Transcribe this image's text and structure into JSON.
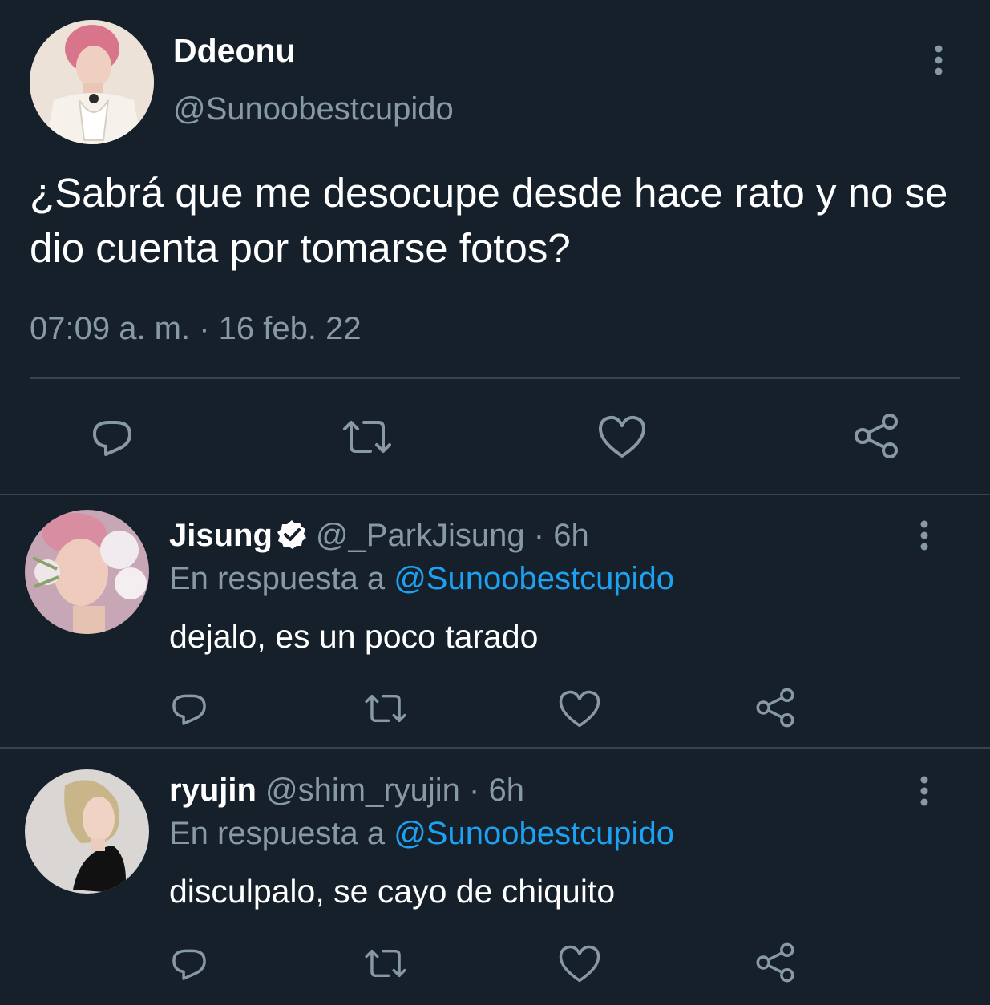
{
  "main_tweet": {
    "display_name": "Ddeonu",
    "handle": "@Sunoobestcupido",
    "text": "¿Sabrá que me desocupe desde hace rato y no se dio cuenta por tomarse fotos?",
    "timestamp": "07:09 a. m. · 16 feb. 22",
    "actions": [
      "reply-icon",
      "retweet-icon",
      "like-icon",
      "share-icon"
    ]
  },
  "replies": [
    {
      "display_name": "Jisung",
      "verified": true,
      "handle": "@_ParkJisung",
      "time": "· 6h",
      "reply_prefix": "En respuesta a",
      "reply_to": "@Sunoobestcupido",
      "text": "dejalo, es un poco tarado"
    },
    {
      "display_name": "ryujin",
      "verified": false,
      "handle": "@shim_ryujin",
      "time": "· 6h",
      "reply_prefix": "En respuesta a",
      "reply_to": "@Sunoobestcupido",
      "text": "disculpalo, se cayo de chiquito"
    }
  ],
  "colors": {
    "background": "#15202b",
    "secondary_text": "#8899a6",
    "link": "#1da1f2",
    "divider": "#38444d"
  }
}
